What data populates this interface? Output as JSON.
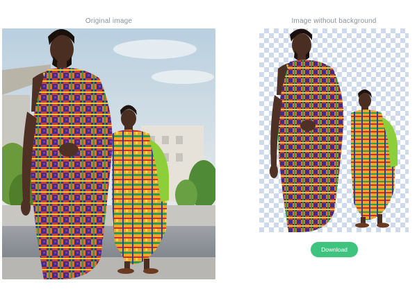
{
  "panels": {
    "original": {
      "title": "Original image"
    },
    "result": {
      "title": "Image without background"
    }
  },
  "actions": {
    "download_label": "Download"
  },
  "colors": {
    "accent": "#3fc47f",
    "title_text": "#8a8f98",
    "checker": "#cfd9ec"
  }
}
